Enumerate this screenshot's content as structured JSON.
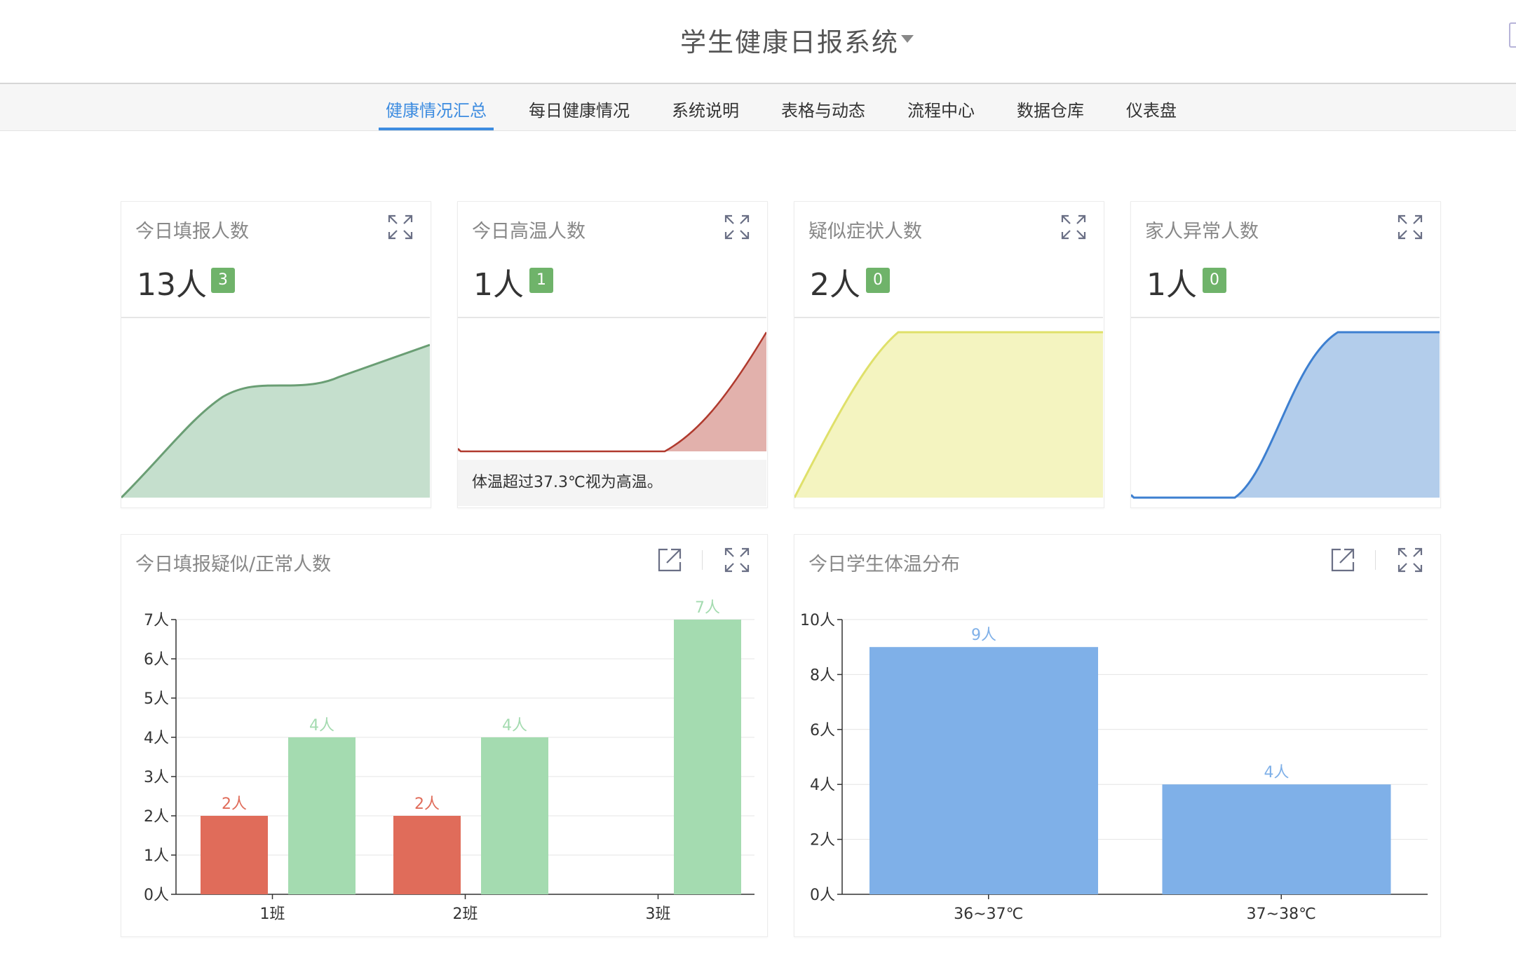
{
  "app": {
    "title": "学生健康日报系统"
  },
  "nav": {
    "tabs": [
      {
        "label": "健康情况汇总",
        "active": true
      },
      {
        "label": "每日健康情况",
        "active": false
      },
      {
        "label": "系统说明",
        "active": false
      },
      {
        "label": "表格与动态",
        "active": false
      },
      {
        "label": "流程中心",
        "active": false
      },
      {
        "label": "数据仓库",
        "active": false
      },
      {
        "label": "仪表盘",
        "active": false
      }
    ]
  },
  "colors": {
    "accent": "#3d8ce0",
    "badge": "#6fb36a",
    "green_line": "#6a9e74",
    "green_fill": "#c5dfcd",
    "red_line": "#b03a2e",
    "red_fill": "#e2b1ac",
    "yellow_line": "#dfe06a",
    "yellow_fill": "#f4f4c0",
    "blue_line": "#3d7fd0",
    "blue_fill": "#b3cdeb",
    "bar_red": "#e06c5a",
    "bar_green": "#a4dbb0",
    "bar_blue": "#7fb0e8"
  },
  "stats": [
    {
      "title": "今日填报人数",
      "value": "13人",
      "badge": "3",
      "icon": "expand-icon"
    },
    {
      "title": "今日高温人数",
      "value": "1人",
      "badge": "1",
      "icon": "expand-icon",
      "note": "体温超过37.3℃视为高温。"
    },
    {
      "title": "疑似症状人数",
      "value": "2人",
      "badge": "0",
      "icon": "expand-icon"
    },
    {
      "title": "家人异常人数",
      "value": "1人",
      "badge": "0",
      "icon": "expand-icon"
    }
  ],
  "panels": {
    "left": {
      "title": "今日填报疑似/正常人数",
      "icons": [
        "external-link-icon",
        "expand-icon"
      ]
    },
    "right": {
      "title": "今日学生体温分布",
      "icons": [
        "external-link-icon",
        "expand-icon"
      ]
    }
  },
  "chart_data": [
    {
      "type": "bar",
      "title": "今日填报疑似/正常人数",
      "categories": [
        "1班",
        "2班",
        "3班"
      ],
      "series": [
        {
          "values": [
            2,
            2,
            0
          ],
          "labels": [
            "2人",
            "2人",
            ""
          ],
          "color": "#e06c5a"
        },
        {
          "values": [
            4,
            4,
            7
          ],
          "labels": [
            "4人",
            "4人",
            "7人"
          ],
          "color": "#a4dbb0"
        }
      ],
      "ylim": [
        0,
        7
      ],
      "yticks": [
        "0人",
        "1人",
        "2人",
        "3人",
        "4人",
        "5人",
        "6人",
        "7人"
      ],
      "grid": true
    },
    {
      "type": "bar",
      "title": "今日学生体温分布",
      "categories": [
        "36~37℃",
        "37~38℃"
      ],
      "series": [
        {
          "values": [
            9,
            4
          ],
          "labels": [
            "9人",
            "4人"
          ],
          "color": "#7fb0e8"
        }
      ],
      "ylim": [
        0,
        10
      ],
      "yticks": [
        "0人",
        "2人",
        "4人",
        "6人",
        "8人",
        "10人"
      ],
      "grid": true
    }
  ]
}
